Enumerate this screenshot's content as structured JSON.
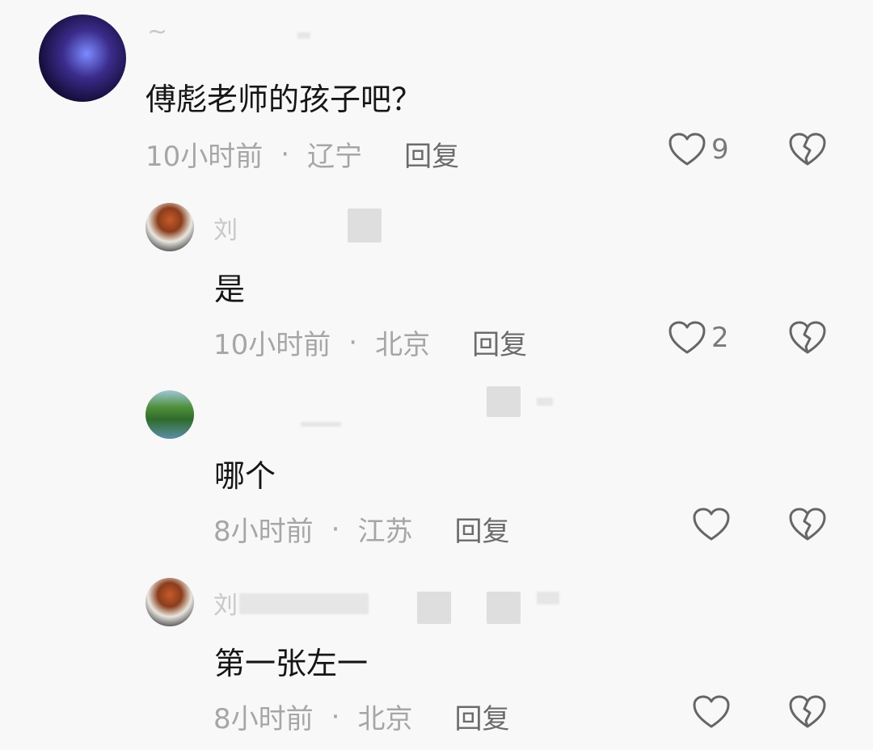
{
  "comments": [
    {
      "username": "~",
      "text": "傅彪老师的孩子吧？",
      "time": "10小时前",
      "separator": "·",
      "location": "辽宁",
      "reply_label": "回复",
      "likes": "9"
    },
    {
      "username": "刘",
      "text": "是",
      "time": "10小时前",
      "separator": "·",
      "location": "北京",
      "reply_label": "回复",
      "likes": "2"
    },
    {
      "username": "",
      "text": "哪个",
      "time": "8小时前",
      "separator": "·",
      "location": "江苏",
      "reply_label": "回复",
      "likes": ""
    },
    {
      "username": "刘",
      "text": "第一张左一",
      "time": "8小时前",
      "separator": "·",
      "location": "北京",
      "reply_label": "回复",
      "likes": ""
    }
  ]
}
